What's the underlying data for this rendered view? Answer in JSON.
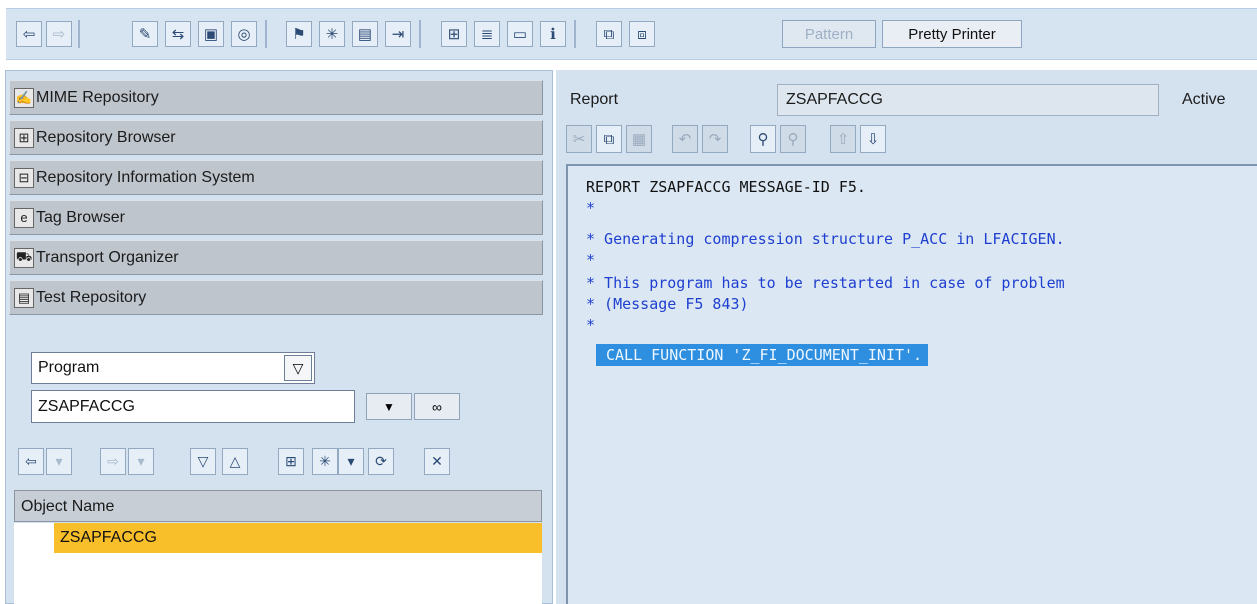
{
  "toolbar": {
    "pattern_label": "Pattern",
    "pretty_printer_label": "Pretty Printer"
  },
  "navigator": {
    "items": [
      {
        "label": "MIME Repository",
        "icon": "mime-icon"
      },
      {
        "label": "Repository Browser",
        "icon": "repository-browser-icon"
      },
      {
        "label": "Repository Information System",
        "icon": "info-system-icon"
      },
      {
        "label": "Tag Browser",
        "icon": "tag-browser-icon"
      },
      {
        "label": "Transport Organizer",
        "icon": "truck-icon"
      },
      {
        "label": "Test Repository",
        "icon": "test-repository-icon"
      }
    ],
    "object_type": "Program",
    "object_name": "ZSAPFACCG",
    "tree_header": "Object Name",
    "tree_selected": "ZSAPFACCG"
  },
  "editor": {
    "report_label": "Report",
    "report_name": "ZSAPFACCG",
    "status": "Active",
    "lines": [
      "REPORT ZSAPFACCG MESSAGE-ID F5.",
      "*",
      "* Generating compression structure P_ACC in LFACIGEN.",
      "*",
      "* This program has to be restarted in case of problem",
      "* (Message F5 843)",
      "*",
      "CALL FUNCTION 'Z_FI_DOCUMENT_INIT'."
    ]
  },
  "colors": {
    "selection_highlight": "#f8bf2a",
    "code_highlight": "#2e8fe0",
    "comment_text": "#1e3fd0"
  }
}
